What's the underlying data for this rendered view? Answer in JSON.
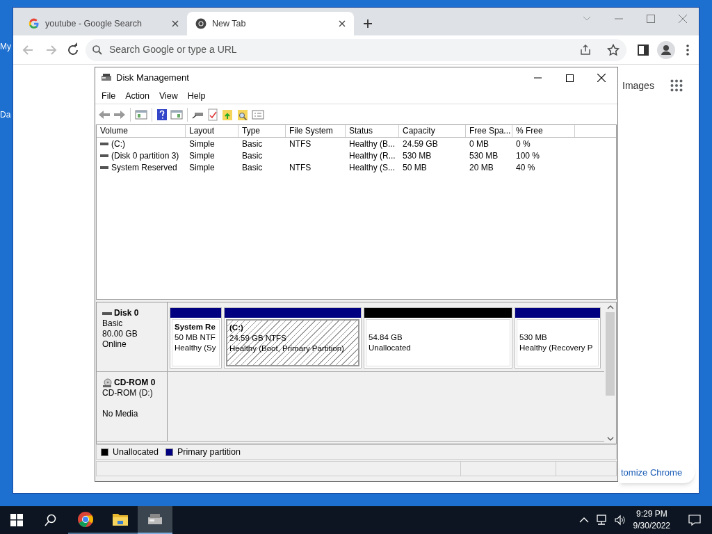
{
  "desktop_icons": [
    {
      "label": "My"
    },
    {
      "label": "Da"
    }
  ],
  "browser": {
    "tabs": [
      {
        "title": "youtube - Google Search",
        "kind": "google",
        "selected": false
      },
      {
        "title": "New Tab",
        "kind": "chrome",
        "selected": true
      }
    ],
    "address": {
      "placeholder": "Search Google or type a URL"
    },
    "page": {
      "images_link": "Images",
      "customize_button": "tomize Chrome"
    }
  },
  "disk_management": {
    "title": "Disk Management",
    "menu": [
      "File",
      "Action",
      "View",
      "Help"
    ],
    "columns": [
      "Volume",
      "Layout",
      "Type",
      "File System",
      "Status",
      "Capacity",
      "Free Spa...",
      "% Free"
    ],
    "rows": [
      {
        "cells": [
          "(C:)",
          "Simple",
          "Basic",
          "NTFS",
          "Healthy (B...",
          "24.59 GB",
          "0 MB",
          "0 %"
        ]
      },
      {
        "cells": [
          "(Disk 0 partition 3)",
          "Simple",
          "Basic",
          "",
          "Healthy (R...",
          "530 MB",
          "530 MB",
          "100 %"
        ]
      },
      {
        "cells": [
          "System Reserved",
          "Simple",
          "Basic",
          "NTFS",
          "Healthy (S...",
          "50 MB",
          "20 MB",
          "40 %"
        ]
      }
    ],
    "disks": [
      {
        "kind": "disk",
        "name": "Disk 0",
        "lines": [
          "Basic",
          "80.00 GB",
          "Online"
        ],
        "partitions": [
          {
            "kind": "primary",
            "name": "System Re",
            "size": "50 MB NTF",
            "status": "Healthy (Sy",
            "selected": false
          },
          {
            "kind": "primary",
            "name": "(C:)",
            "size": "24.59 GB NTFS",
            "status": "Healthy (Boot, Primary Partition)",
            "selected": true
          },
          {
            "kind": "unallocated",
            "size": "54.84 GB",
            "status": "Unallocated",
            "selected": false
          },
          {
            "kind": "primary",
            "size": "530 MB",
            "status": "Healthy (Recovery P",
            "selected": false
          }
        ]
      },
      {
        "kind": "cdrom",
        "name": "CD-ROM 0",
        "lines": [
          "CD-ROM (D:)",
          "No Media"
        ]
      }
    ],
    "legend": [
      {
        "label": "Unallocated",
        "color": "#000000"
      },
      {
        "label": "Primary partition",
        "color": "#000080"
      }
    ]
  },
  "taskbar": {
    "apps": [
      {
        "kind": "chrome",
        "active": false
      },
      {
        "kind": "explorer",
        "active": false
      },
      {
        "kind": "diskmgmt",
        "active": true
      }
    ],
    "time": "9:29 PM",
    "date": "9/30/2022"
  }
}
